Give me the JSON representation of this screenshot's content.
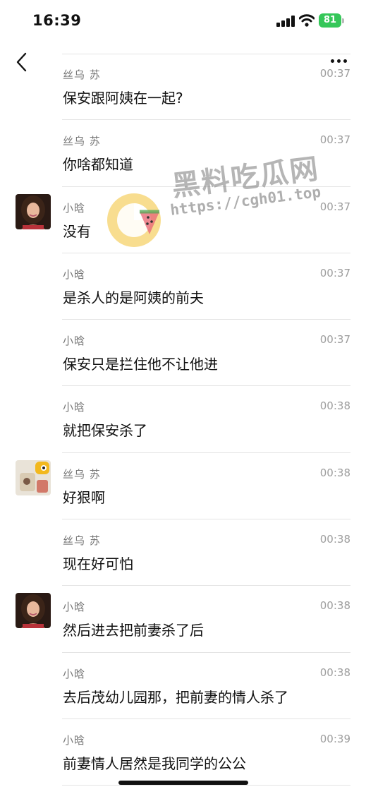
{
  "status_bar": {
    "time": "16:39",
    "battery": "81"
  },
  "watermark": {
    "title": "黑料吃瓜网",
    "url": "https://cgh01.top"
  },
  "messages": [
    {
      "sender": "丝乌 苏",
      "time": "00:37",
      "text": "保安跟阿姨在一起?",
      "avatar": ""
    },
    {
      "sender": "丝乌 苏",
      "time": "00:37",
      "text": "你啥都知道",
      "avatar": ""
    },
    {
      "sender": "小晗",
      "time": "00:37",
      "text": "没有",
      "avatar": "girl"
    },
    {
      "sender": "小晗",
      "time": "00:37",
      "text": "是杀人的是阿姨的前夫",
      "avatar": ""
    },
    {
      "sender": "小晗",
      "time": "00:37",
      "text": "保安只是拦住他不让他进",
      "avatar": ""
    },
    {
      "sender": "小晗",
      "time": "00:38",
      "text": "就把保安杀了",
      "avatar": ""
    },
    {
      "sender": "丝乌 苏",
      "time": "00:38",
      "text": "好狠啊",
      "avatar": "toy"
    },
    {
      "sender": "丝乌 苏",
      "time": "00:38",
      "text": "现在好可怕",
      "avatar": ""
    },
    {
      "sender": "小晗",
      "time": "00:38",
      "text": "然后进去把前妻杀了后",
      "avatar": "girl"
    },
    {
      "sender": "小晗",
      "time": "00:38",
      "text": "去后茂幼儿园那，把前妻的情人杀了",
      "avatar": ""
    },
    {
      "sender": "小晗",
      "time": "00:39",
      "text": "前妻情人居然是我同学的公公",
      "avatar": ""
    }
  ]
}
